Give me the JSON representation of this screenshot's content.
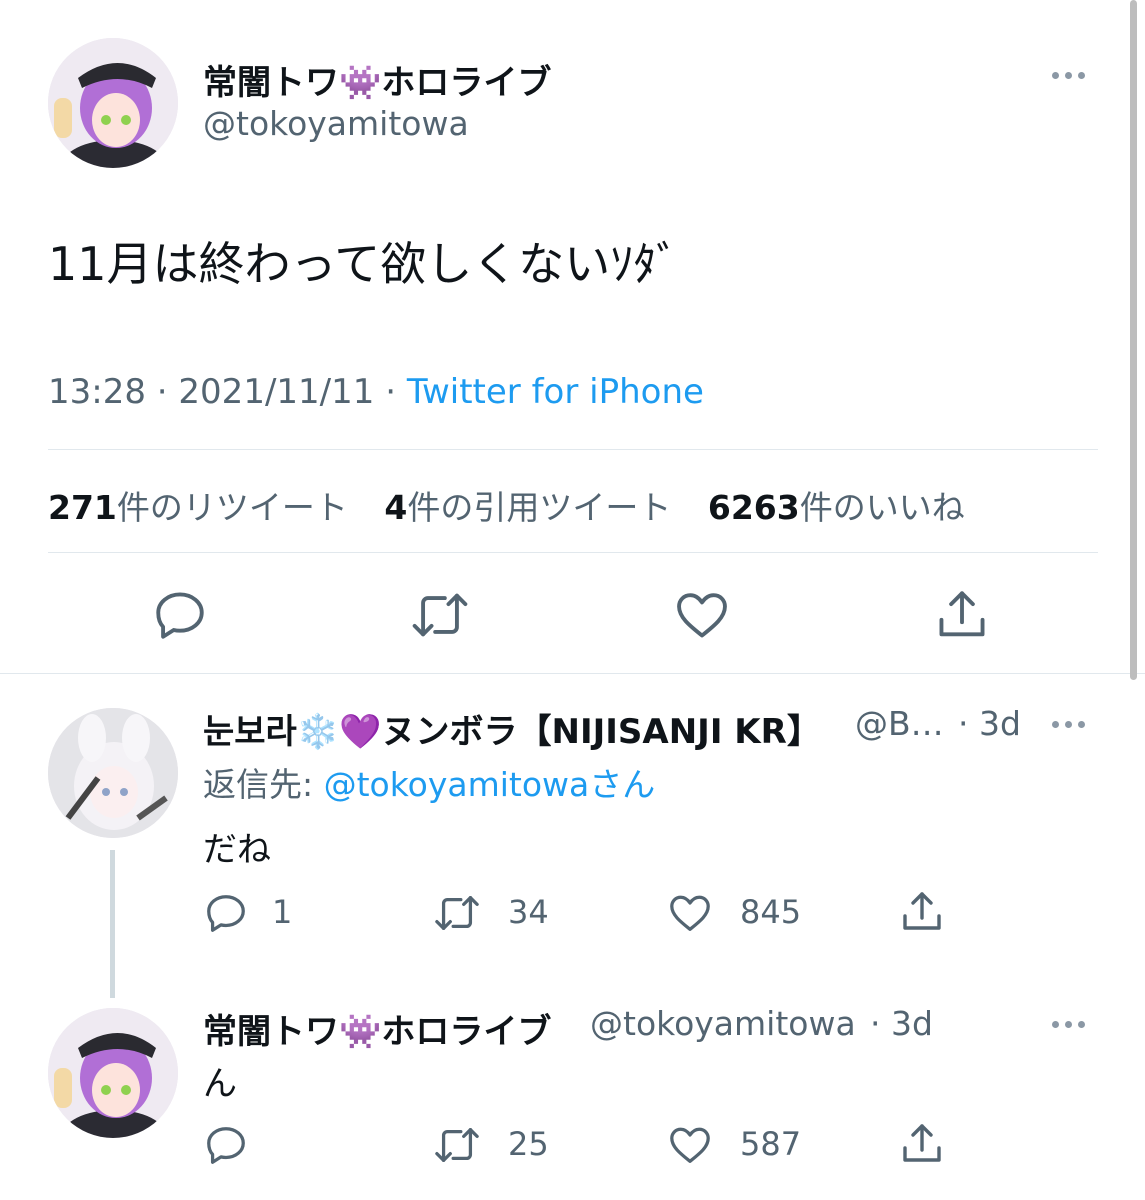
{
  "main_tweet": {
    "display_name": "常闇トワ👾ホロライブ",
    "handle": "@tokoyamitowa",
    "text": "11月は終わって欲しくないｿﾀﾞ",
    "time": "13:28",
    "date": "2021/11/11",
    "separator": "·",
    "source": "Twitter for iPhone",
    "stats": {
      "retweets_count": "271",
      "retweets_label": "件のリツイート",
      "quotes_count": "4",
      "quotes_label": "件の引用ツイート",
      "likes_count": "6263",
      "likes_label": "件のいいね"
    }
  },
  "replies": [
    {
      "display_name": "눈보라❄️💜ヌンボラ【NIJISANJI KR】",
      "handle": "@B…",
      "age": "· 3d",
      "reply_to_prefix": "返信先: ",
      "reply_to_handle": "@tokoyamitowa",
      "reply_to_suffix": "さん",
      "text": "だね",
      "reply_count": "1",
      "retweet_count": "34",
      "like_count": "845"
    },
    {
      "display_name": "常闇トワ👾ホロライブ",
      "handle": "@tokoyamitowa",
      "age": "· 3d",
      "text": "ん",
      "reply_count": "",
      "retweet_count": "25",
      "like_count": "587"
    }
  ],
  "icons": [
    "more-icon",
    "reply-icon",
    "retweet-icon",
    "like-icon",
    "share-icon"
  ],
  "colors": {
    "link": "#1d9bf0",
    "secondary": "#536471",
    "divider": "#e1e8ed"
  }
}
